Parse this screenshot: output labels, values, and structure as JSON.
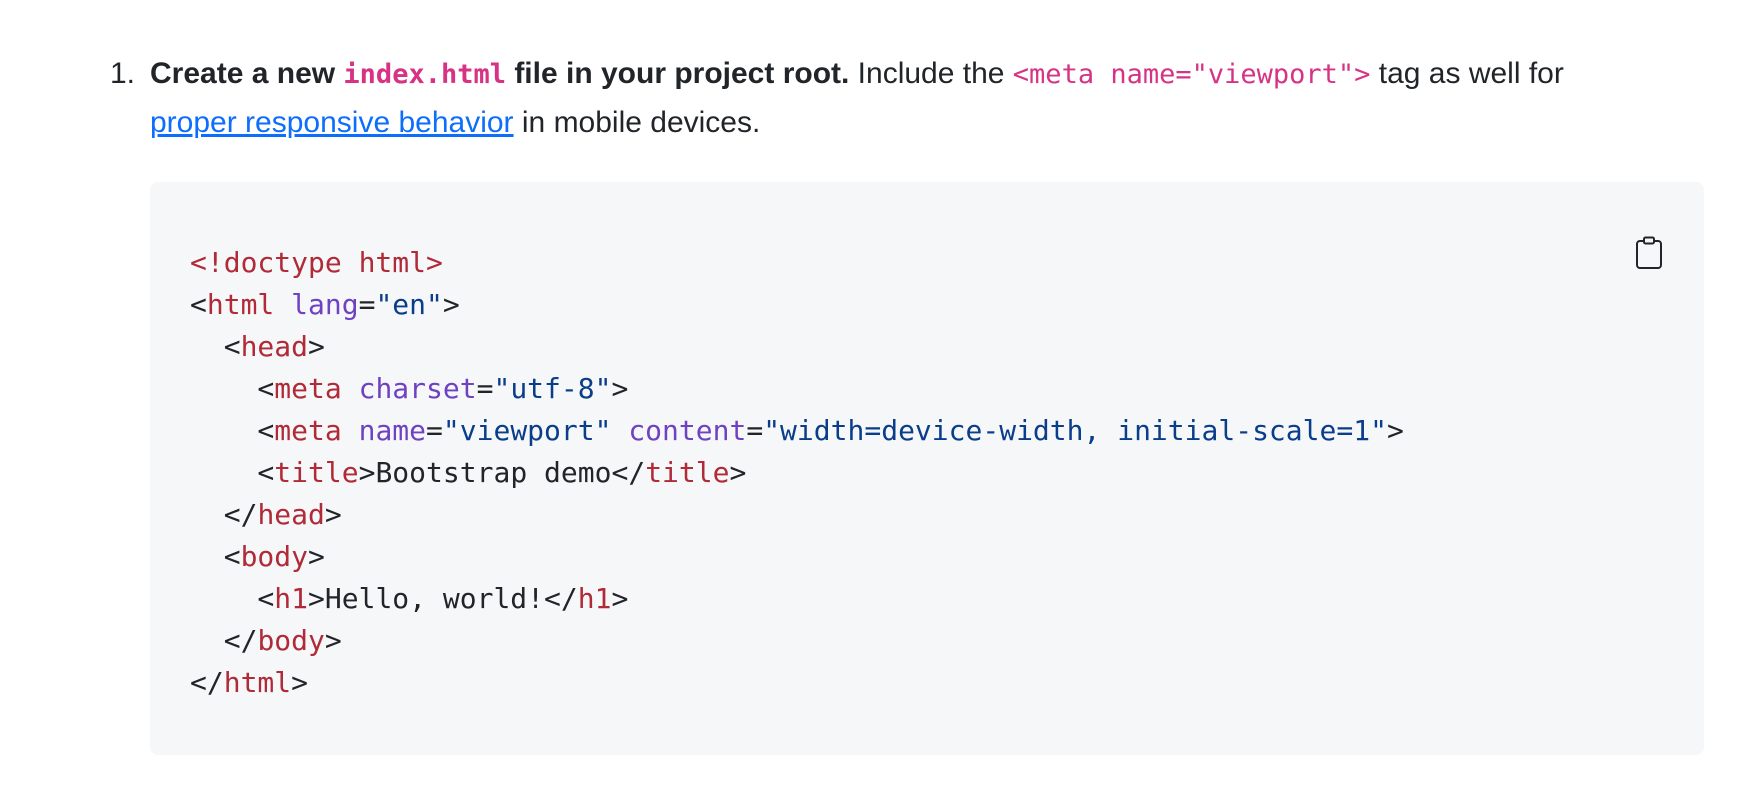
{
  "step": {
    "number": "1.",
    "lead_bold_1": "Create a new ",
    "lead_code": "index.html",
    "lead_bold_2": " file in your project root.",
    "text_1": " Include the ",
    "meta_code": "<meta name=\"viewport\">",
    "text_2": " tag as well for",
    "link_text": "proper responsive behavior",
    "text_3": " in mobile devices."
  },
  "code_block": {
    "copy_icon": "clipboard-icon",
    "lines": [
      [
        {
          "c": "tag",
          "t": "<!doctype html>"
        }
      ],
      [
        {
          "c": "punc",
          "t": "<"
        },
        {
          "c": "tag",
          "t": "html"
        },
        {
          "c": "punc",
          "t": " "
        },
        {
          "c": "attr",
          "t": "lang"
        },
        {
          "c": "punc",
          "t": "="
        },
        {
          "c": "str",
          "t": "\"en\""
        },
        {
          "c": "punc",
          "t": ">"
        }
      ],
      [
        {
          "c": "punc",
          "t": "  <"
        },
        {
          "c": "tag",
          "t": "head"
        },
        {
          "c": "punc",
          "t": ">"
        }
      ],
      [
        {
          "c": "punc",
          "t": "    <"
        },
        {
          "c": "tag",
          "t": "meta"
        },
        {
          "c": "punc",
          "t": " "
        },
        {
          "c": "attr",
          "t": "charset"
        },
        {
          "c": "punc",
          "t": "="
        },
        {
          "c": "str",
          "t": "\"utf-8\""
        },
        {
          "c": "punc",
          "t": ">"
        }
      ],
      [
        {
          "c": "punc",
          "t": "    <"
        },
        {
          "c": "tag",
          "t": "meta"
        },
        {
          "c": "punc",
          "t": " "
        },
        {
          "c": "attr",
          "t": "name"
        },
        {
          "c": "punc",
          "t": "="
        },
        {
          "c": "str",
          "t": "\"viewport\""
        },
        {
          "c": "punc",
          "t": " "
        },
        {
          "c": "attr",
          "t": "content"
        },
        {
          "c": "punc",
          "t": "="
        },
        {
          "c": "str",
          "t": "\"width=device-width, initial-scale=1\""
        },
        {
          "c": "punc",
          "t": ">"
        }
      ],
      [
        {
          "c": "punc",
          "t": "    <"
        },
        {
          "c": "tag",
          "t": "title"
        },
        {
          "c": "punc",
          "t": ">"
        },
        {
          "c": "text",
          "t": "Bootstrap demo"
        },
        {
          "c": "punc",
          "t": "</"
        },
        {
          "c": "tag",
          "t": "title"
        },
        {
          "c": "punc",
          "t": ">"
        }
      ],
      [
        {
          "c": "punc",
          "t": "  </"
        },
        {
          "c": "tag",
          "t": "head"
        },
        {
          "c": "punc",
          "t": ">"
        }
      ],
      [
        {
          "c": "punc",
          "t": "  <"
        },
        {
          "c": "tag",
          "t": "body"
        },
        {
          "c": "punc",
          "t": ">"
        }
      ],
      [
        {
          "c": "punc",
          "t": "    <"
        },
        {
          "c": "tag",
          "t": "h1"
        },
        {
          "c": "punc",
          "t": ">"
        },
        {
          "c": "text",
          "t": "Hello, world!"
        },
        {
          "c": "punc",
          "t": "</"
        },
        {
          "c": "tag",
          "t": "h1"
        },
        {
          "c": "punc",
          "t": ">"
        }
      ],
      [
        {
          "c": "punc",
          "t": "  </"
        },
        {
          "c": "tag",
          "t": "body"
        },
        {
          "c": "punc",
          "t": ">"
        }
      ],
      [
        {
          "c": "punc",
          "t": "</"
        },
        {
          "c": "tag",
          "t": "html"
        },
        {
          "c": "punc",
          "t": ">"
        }
      ]
    ]
  },
  "colors": {
    "tag": "#b02a37",
    "attr": "#6f42c1",
    "string": "#0a3d8a",
    "inline_code": "#d63384",
    "link": "#0d6efd",
    "code_background": "#f6f7f9"
  }
}
